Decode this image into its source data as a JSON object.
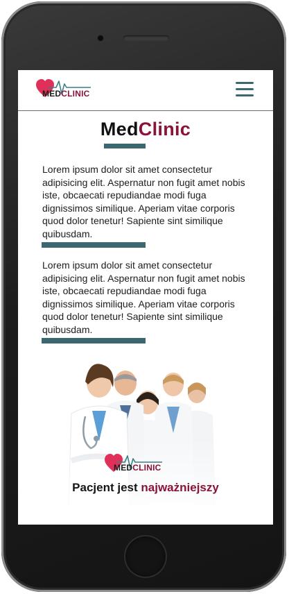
{
  "brand": {
    "logo_med": "MED",
    "logo_clinic": "CLINIC",
    "title_part1": "Med",
    "title_part2": "Clinic"
  },
  "navbar": {
    "menu_icon": "hamburger-menu-icon"
  },
  "paragraphs": [
    "Lorem ipsum dolor sit amet consectetur adipisicing elit. Aspernatur non fugit amet nobis iste, obcaecati repudiandae modi fuga dignissimos similique. Aperiam vitae corporis quod dolor tenetur! Sapiente sint similique quibusdam.",
    "Lorem ipsum dolor sit amet consectetur adipisicing elit. Aspernatur non fugit amet nobis iste, obcaecati repudiandae modi fuga dignissimos similique. Aperiam vitae corporis quod dolor tenetur! Sapiente sint similique quibusdam."
  ],
  "hero": {
    "image": "doctors-team-photo",
    "slogan_prefix": "Pacjent jest ",
    "slogan_highlight": "najważniejszy"
  },
  "colors": {
    "accent_teal": "#3a6770",
    "brand_red": "#8c1237",
    "heart_red": "#e0305a"
  }
}
